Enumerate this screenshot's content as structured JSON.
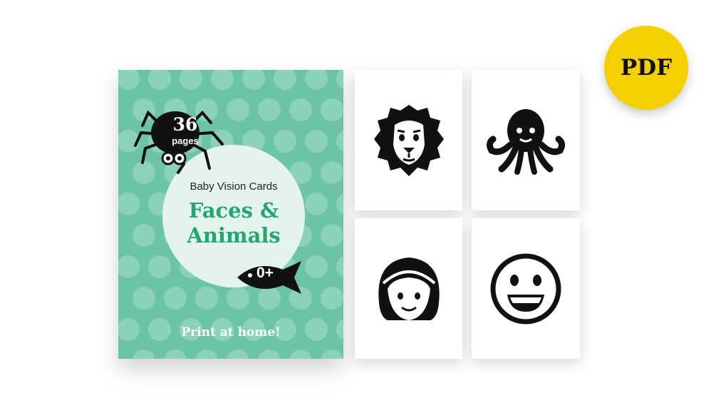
{
  "cover": {
    "page_count": "36",
    "page_label": "pages",
    "subtitle": "Baby Vision Cards",
    "title_line1": "Faces &",
    "title_line2": "Animals",
    "age": "0+",
    "print_note": "Print at home!"
  },
  "badge": {
    "label": "PDF"
  },
  "cards": [
    {
      "icon": "lion-face-icon"
    },
    {
      "icon": "octopus-icon"
    },
    {
      "icon": "girl-face-icon"
    },
    {
      "icon": "smiley-face-icon"
    }
  ],
  "colors": {
    "cover_bg": "#6cc4a6",
    "title_green": "#22a76c",
    "badge_yellow": "#f5d000"
  }
}
